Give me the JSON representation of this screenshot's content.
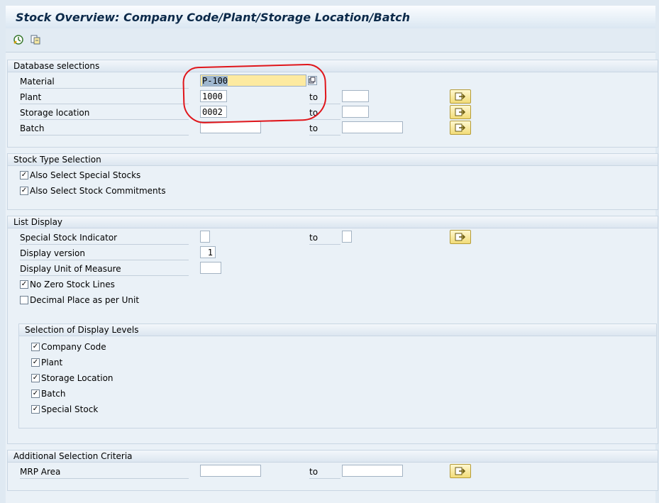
{
  "window": {
    "title": "Stock Overview: Company Code/Plant/Storage Location/Batch"
  },
  "toolbar": {
    "execute_icon": "execute-clock-icon",
    "variant_icon": "get-variant-icon"
  },
  "database_selections": {
    "header": "Database selections",
    "to_label": "to",
    "rows": [
      {
        "label": "Material",
        "value": "P-100",
        "to_value": ""
      },
      {
        "label": "Plant",
        "value": "1000",
        "to_value": ""
      },
      {
        "label": "Storage location",
        "value": "0002",
        "to_value": ""
      },
      {
        "label": "Batch",
        "value": "",
        "to_value": ""
      }
    ]
  },
  "stock_type": {
    "header": "Stock Type Selection",
    "options": [
      {
        "label": "Also Select Special Stocks",
        "checked": true
      },
      {
        "label": "Also Select Stock Commitments",
        "checked": true
      }
    ]
  },
  "list_display": {
    "header": "List Display",
    "to_label": "to",
    "special_stock_indicator": {
      "label": "Special Stock Indicator",
      "value": "",
      "to_value": ""
    },
    "display_version": {
      "label": "Display version",
      "value": "1"
    },
    "display_uom": {
      "label": "Display Unit of Measure",
      "value": ""
    },
    "options": [
      {
        "label": "No Zero Stock Lines",
        "checked": true
      },
      {
        "label": "Decimal Place as per Unit",
        "checked": false
      }
    ],
    "display_levels": {
      "header": "Selection of Display Levels",
      "options": [
        {
          "label": "Company Code",
          "checked": true
        },
        {
          "label": "Plant",
          "checked": true
        },
        {
          "label": "Storage Location",
          "checked": true
        },
        {
          "label": "Batch",
          "checked": true
        },
        {
          "label": "Special Stock",
          "checked": true
        }
      ]
    }
  },
  "additional": {
    "header": "Additional Selection Criteria",
    "to_label": "to",
    "mrp_area": {
      "label": "MRP Area",
      "value": "",
      "to_value": ""
    }
  },
  "colors": {
    "annotation": "#e0161b",
    "active_field": "#fdeaa0",
    "multi_select_button": "#f2dc78"
  }
}
